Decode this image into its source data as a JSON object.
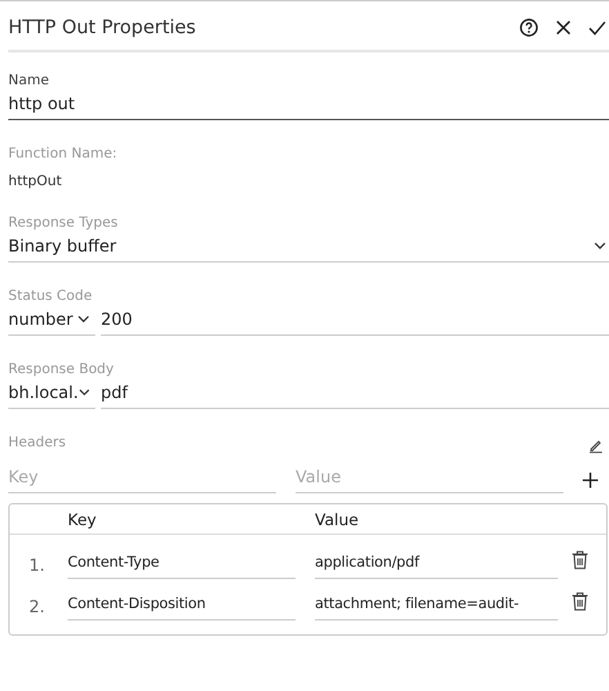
{
  "window": {
    "title": "HTTP Out Properties"
  },
  "name": {
    "label": "Name",
    "value": "http out"
  },
  "function_name": {
    "label": "Function Name:",
    "value": "httpOut"
  },
  "response_types": {
    "label": "Response Types",
    "value": "Binary buffer"
  },
  "status_code": {
    "label": "Status Code",
    "type": "number",
    "value": "200"
  },
  "response_body": {
    "label": "Response Body",
    "type": "bh.local.",
    "value": "pdf"
  },
  "headers": {
    "label": "Headers",
    "key_placeholder": "Key",
    "value_placeholder": "Value",
    "columns": [
      "Key",
      "Value"
    ],
    "rows": [
      {
        "index": "1.",
        "key": "Content-Type",
        "value": "application/pdf"
      },
      {
        "index": "2.",
        "key": "Content-Disposition",
        "value": "attachment; filename=audit-"
      }
    ]
  }
}
